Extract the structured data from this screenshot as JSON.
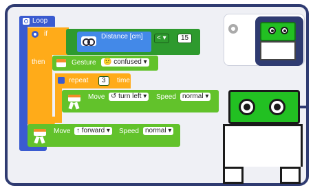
{
  "program": {
    "loop_label": "Loop",
    "if_label": "if",
    "then_label": "then",
    "condition": {
      "sensor_label": "Distance [cm]",
      "operator": "<",
      "value": "15"
    },
    "gesture": {
      "label": "Gesture",
      "face_icon": "😕",
      "value": "confused"
    },
    "repeat": {
      "label": "repeat",
      "count": "3",
      "suffix": "time"
    },
    "move_inner": {
      "label": "Move",
      "direction_icon": "↺",
      "direction": "turn left",
      "speed_label": "Speed",
      "speed": "normal"
    },
    "move_outer": {
      "label": "Move",
      "direction_icon": "↑",
      "direction": "forward",
      "speed_label": "Speed",
      "speed": "normal"
    }
  },
  "colors": {
    "frame": "#2f3b71",
    "loop": "#3a5bd0",
    "control": "#ffab19",
    "sensor": "#4389e8",
    "motion": "#62c22b",
    "robot_face": "#22c022"
  }
}
